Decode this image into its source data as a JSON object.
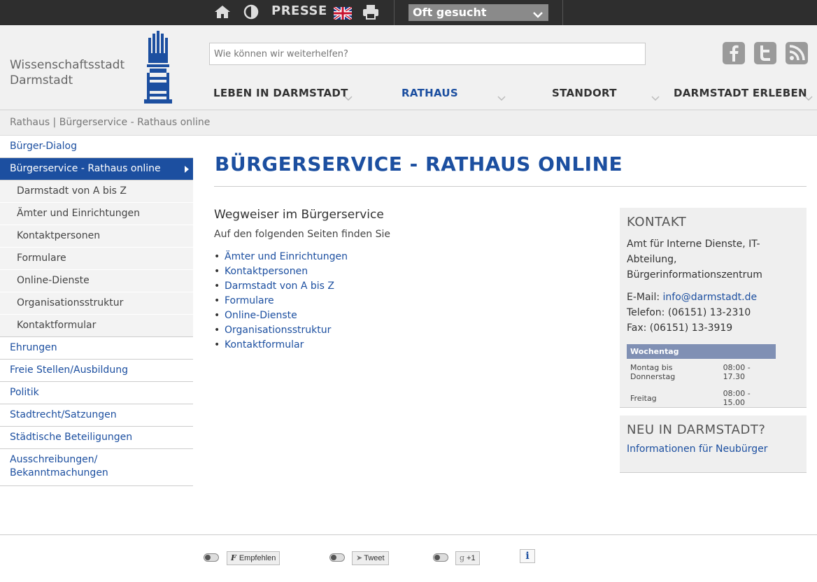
{
  "topbar": {
    "presse_label": "PRESSE",
    "select_value": "Oft gesucht",
    "icons": [
      "home-icon",
      "contrast-icon",
      "uk-flag-icon",
      "print-icon",
      "chevron-down-icon"
    ]
  },
  "header": {
    "logo_line1": "Wissenschaftsstadt",
    "logo_line2": "Darmstadt",
    "search_placeholder": "Wie können wir weiterhelfen?",
    "social": [
      "facebook-icon",
      "twitter-icon",
      "rss-icon"
    ],
    "nav": [
      {
        "label": "LEBEN IN DARMSTADT"
      },
      {
        "label": "RATHAUS"
      },
      {
        "label": "STANDORT"
      },
      {
        "label": "DARMSTADT ERLEBEN"
      }
    ]
  },
  "breadcrumb": "Rathaus | Bürgerservice - Rathaus online",
  "sidebar": {
    "items": [
      {
        "label": "Bürger-Dialog"
      },
      {
        "label": "Bürgerservice - Rathaus online"
      },
      {
        "label": "Ehrungen"
      },
      {
        "label": "Freie Stellen/Ausbildung"
      },
      {
        "label": "Politik"
      },
      {
        "label": "Stadtrecht/Satzungen"
      },
      {
        "label": "Städtische Beteiligungen"
      },
      {
        "label": "Ausschreibungen/ Bekanntmachungen"
      }
    ],
    "subitems": [
      {
        "label": "Darmstadt von A bis Z"
      },
      {
        "label": "Ämter und Einrichtungen"
      },
      {
        "label": "Kontaktpersonen"
      },
      {
        "label": "Formulare"
      },
      {
        "label": "Online-Dienste"
      },
      {
        "label": "Organisationsstruktur"
      },
      {
        "label": "Kontaktformular"
      }
    ]
  },
  "main": {
    "title": "BÜRGERSERVICE - RATHAUS ONLINE",
    "heading": "Wegweiser im Bürgerservice",
    "intro": "Auf den folgenden Seiten finden Sie",
    "links": [
      {
        "label": "Ämter und Einrichtungen"
      },
      {
        "label": "Kontaktpersonen"
      },
      {
        "label": "Darmstadt von A bis Z"
      },
      {
        "label": "Formulare"
      },
      {
        "label": "Online-Dienste"
      },
      {
        "label": "Organisationsstruktur"
      },
      {
        "label": "Kontaktformular"
      }
    ]
  },
  "contact": {
    "heading": "KONTAKT",
    "org": "Amt für Interne Dienste, IT-Abteilung, Bürgerinformationszentrum",
    "email_label": "E-Mail: ",
    "email": "info@darmstadt.de",
    "phone": "Telefon: (06151) 13-2310",
    "fax": "Fax: (06151) 13-3919",
    "hours_header": "Wochentag",
    "hours": [
      {
        "day": "Montag bis Donnerstag",
        "time": "08:00 - 17.30"
      },
      {
        "day": "Freitag",
        "time": "08:00 - 15.00"
      }
    ]
  },
  "neu": {
    "heading": "NEU IN DARMSTADT?",
    "link": "Informationen für Neubürger"
  },
  "footer": {
    "facebook_label": "Empfehlen",
    "twitter_label": "Tweet",
    "gplus_label": "+1",
    "info_label": "i"
  },
  "colors": {
    "brand_blue": "#1c4fa0",
    "topbar": "#2e2e2e",
    "table_header": "#8090b4"
  }
}
